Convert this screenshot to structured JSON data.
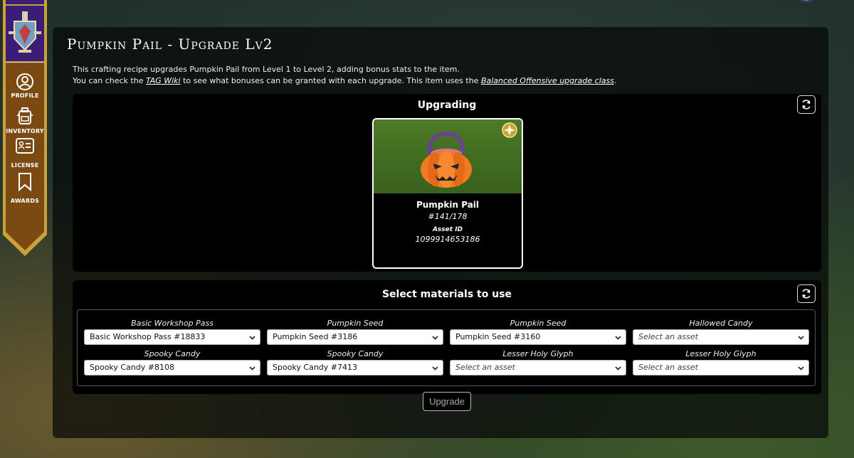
{
  "page": {
    "title": "Pumpkin Pail - Upgrade Lv2",
    "description": {
      "line1": "This crafting recipe upgrades Pumpkin Pail from Level 1 to Level 2, adding bonus stats to the item.",
      "line2_pre": "You can check the ",
      "wiki_link": "TAG Wiki",
      "line2_mid": " to see what bonuses can be granted with each upgrade. This item uses the ",
      "class_link": "Balanced Offensive upgrade class",
      "line2_post": "."
    }
  },
  "nav": {
    "items": [
      {
        "label": "PROFILE",
        "icon": "user-circle-icon"
      },
      {
        "label": "INVENTORY",
        "icon": "backpack-icon"
      },
      {
        "label": "LICENSE",
        "icon": "id-card-icon"
      },
      {
        "label": "AWARDS",
        "icon": "bookmark-icon"
      }
    ]
  },
  "upgrading": {
    "heading": "Upgrading",
    "item": {
      "name": "Pumpkin Pail",
      "serial": "#141/178",
      "asset_label": "Asset ID",
      "asset_id": "1099914653186"
    }
  },
  "materials": {
    "heading": "Select materials to use",
    "slots": [
      {
        "label": "Basic Workshop Pass",
        "value": "Basic Workshop Pass #18833"
      },
      {
        "label": "Pumpkin Seed",
        "value": "Pumpkin Seed #3186"
      },
      {
        "label": "Pumpkin Seed",
        "value": "Pumpkin Seed #3160"
      },
      {
        "label": "Hallowed Candy",
        "value": "Select an asset"
      },
      {
        "label": "Spooky Candy",
        "value": "Spooky Candy #8108"
      },
      {
        "label": "Spooky Candy",
        "value": "Spooky Candy #7413"
      },
      {
        "label": "Lesser Holy Glyph",
        "value": "Select an asset"
      },
      {
        "label": "Lesser Holy Glyph",
        "value": "Select an asset"
      }
    ]
  },
  "actions": {
    "upgrade_label": "Upgrade"
  },
  "colors": {
    "banner_purple": "#3b1d78",
    "banner_brown": "#7a4a12",
    "banner_gold": "#c9a23a",
    "card_green": "#4f7a27",
    "pumpkin_orange": "#f07a22"
  }
}
